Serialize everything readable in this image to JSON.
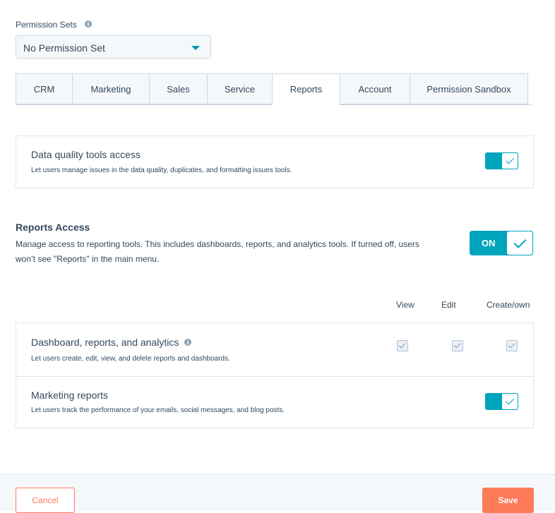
{
  "permission_sets": {
    "label": "Permission Sets",
    "selected": "No Permission Set"
  },
  "tabs": [
    {
      "label": "CRM"
    },
    {
      "label": "Marketing"
    },
    {
      "label": "Sales"
    },
    {
      "label": "Service"
    },
    {
      "label": "Reports",
      "active": true
    },
    {
      "label": "Account"
    },
    {
      "label": "Permission Sandbox"
    }
  ],
  "data_quality": {
    "title": "Data quality tools access",
    "description": "Let users manage issues in the data quality, duplicates, and formatting issues tools.",
    "enabled": true
  },
  "reports_access": {
    "title": "Reports Access",
    "description": "Manage access to reporting tools. This includes dashboards, reports, and analytics tools. If turned off, users won’t see \"Reports\" in the main menu.",
    "toggle_label": "ON",
    "enabled": true
  },
  "columns": {
    "view": "View",
    "edit": "Edit",
    "create_own": "Create/own"
  },
  "dashboard": {
    "title": "Dashboard, reports, and analytics",
    "description": "Let users create, edit, view, and delete reports and dashboards.",
    "view": true,
    "edit": true,
    "create_own": true
  },
  "marketing_reports": {
    "title": "Marketing reports",
    "description": "Let users track the performance of your emails, social messages, and blog posts.",
    "enabled": true
  },
  "footer": {
    "cancel_label": "Cancel",
    "save_label": "Save"
  },
  "colors": {
    "accent": "#00a4bd",
    "primary_button": "#ff7a59",
    "text": "#33475b"
  }
}
